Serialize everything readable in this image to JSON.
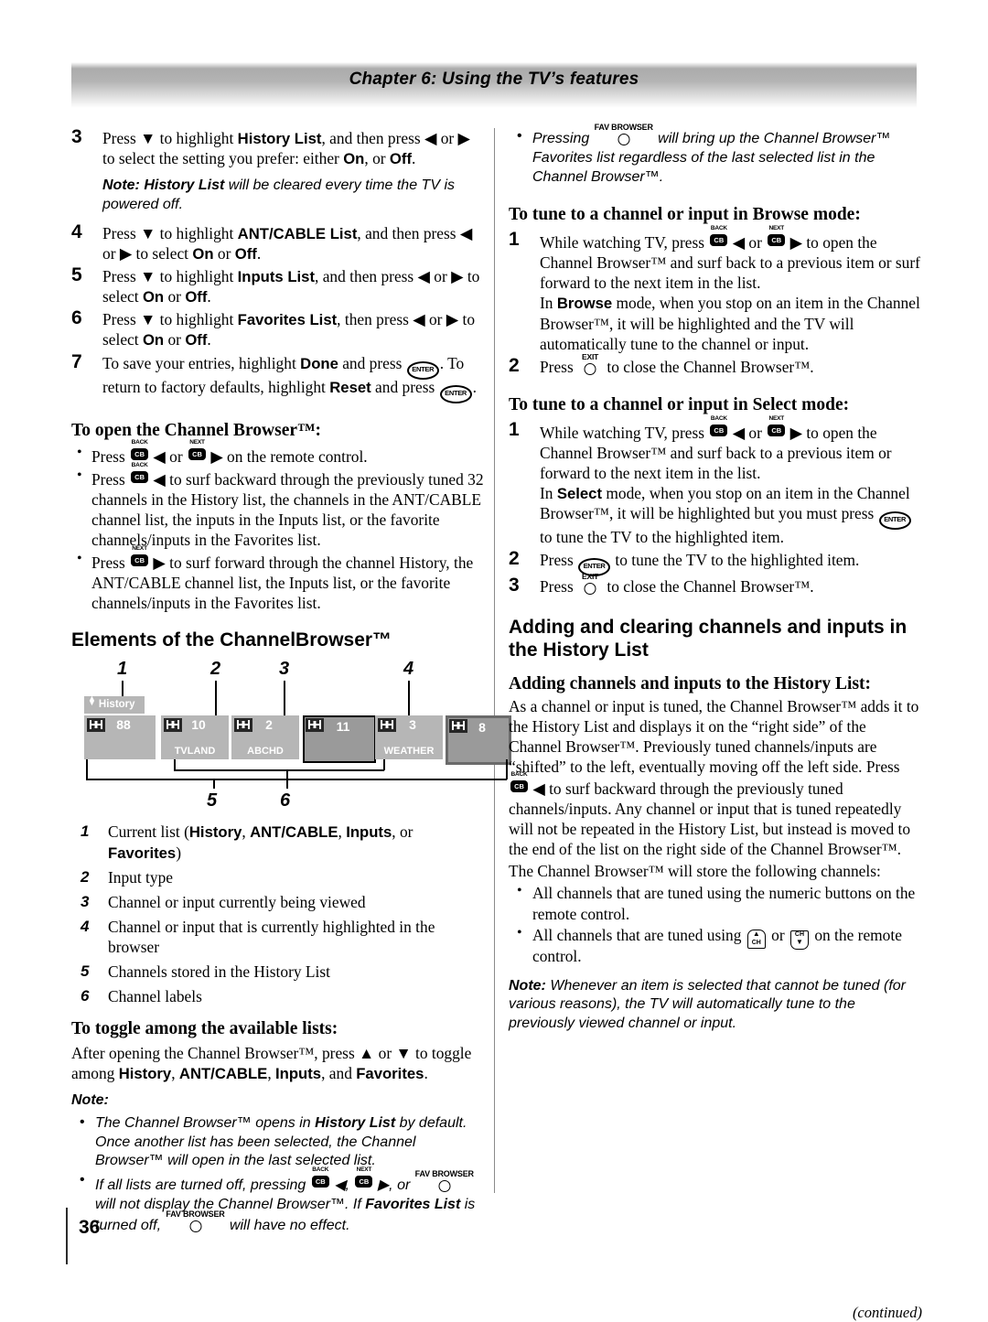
{
  "header": {
    "chapter_title": "Chapter 6: Using the TV’s features"
  },
  "footer": {
    "page_number": "36",
    "continued": "(continued)"
  },
  "left_column": {
    "steps": [
      {
        "num": "3",
        "text_1": "Press ▼ to highlight ",
        "bold_1": "History List",
        "text_2": ", and then press ◀ or ▶ to select the setting you prefer: either ",
        "bold_2": "On",
        "text_3": ", or ",
        "bold_3": "Off",
        "text_4": "."
      },
      {
        "num": "4",
        "text_1": "Press ▼ to highlight ",
        "bold_1": "ANT/CABLE List",
        "text_2": ", and then press ◀ or ▶ to select ",
        "bold_2": "On",
        "text_3": " or ",
        "bold_3": "Off",
        "text_4": "."
      },
      {
        "num": "5",
        "text_1": "Press ▼ to highlight ",
        "bold_1": "Inputs List",
        "text_2": ", and then press ◀ or ▶ to select ",
        "bold_2": "On",
        "text_3": " or ",
        "bold_3": "Off",
        "text_4": "."
      },
      {
        "num": "6",
        "text_1": "Press ▼ to highlight ",
        "bold_1": "Favorites List",
        "text_2": ", then press ◀ or ▶ to select ",
        "bold_2": "On",
        "text_3": " or ",
        "bold_3": "Off",
        "text_4": "."
      }
    ],
    "note_history": {
      "label": "Note: History List",
      "text": " will be cleared every time the TV is powered off."
    },
    "step7": {
      "num": "7",
      "part_1": "To save your entries, highlight ",
      "bold_done": "Done",
      "part_2": " and press ",
      "part_3": ". To return to factory defaults, highlight ",
      "bold_reset": "Reset",
      "part_4": " and press ",
      "part_5": "."
    },
    "open_browser": {
      "heading": "To open the Channel Browser™:",
      "bullets": [
        {
          "pre": "Press ",
          "mid": " ◀ or ",
          "post": " ▶ on the remote control.",
          "type": "two-key"
        },
        {
          "pre": "Press ",
          "post": " ◀ to surf backward through the previously tuned 32 channels in the History list, the channels in the ANT/CABLE channel list, the inputs in the Inputs list, or the favorite channels/inputs in the Favorites list.",
          "type": "back"
        },
        {
          "pre": "Press ",
          "post": " ▶ to surf forward through the channel History, the ANT/CABLE channel list, the Inputs list, or the favorite channels/inputs in the Favorites list.",
          "type": "next"
        }
      ]
    },
    "elements_heading": "Elements of the ChannelBrowser™",
    "figure": {
      "callouts": [
        "1",
        "2",
        "3",
        "4",
        "5",
        "6"
      ],
      "list_tab": "History",
      "cells": [
        {
          "channel": "88",
          "label": "",
          "state": "normal"
        },
        {
          "channel": "10",
          "label": "TVLAND",
          "state": "normal"
        },
        {
          "channel": "2",
          "label": "ABCHD",
          "state": "normal"
        },
        {
          "channel": "11",
          "label": "",
          "state": "viewing"
        },
        {
          "channel": "3",
          "label": "WEATHER",
          "state": "normal"
        },
        {
          "channel": "8",
          "label": "",
          "state": "highlighted"
        }
      ],
      "legend": [
        {
          "num": "1",
          "pre": "Current list (",
          "b1": "History",
          "s1": ", ",
          "b2": "ANT/CABLE",
          "s2": ", ",
          "b3": "Inputs",
          "s3": ", or ",
          "b4": "Favorites",
          "post": ")"
        },
        {
          "num": "2",
          "text": "Input type"
        },
        {
          "num": "3",
          "text": "Channel or input currently being viewed"
        },
        {
          "num": "4",
          "text": "Channel or input that is currently highlighted in the browser"
        },
        {
          "num": "5",
          "text": "Channels stored in the History List"
        },
        {
          "num": "6",
          "text": "Channel labels"
        }
      ]
    },
    "toggle": {
      "heading": "To toggle among the available lists:",
      "p1": "After opening the Channel Browser™, press ▲ or ▼ to toggle among ",
      "b1": "History",
      "s1": ", ",
      "b2": "ANT/CABLE",
      "s2": ", ",
      "b3": "Inputs",
      "s3": ", and ",
      "b4": "Favorites",
      "s4": ".",
      "note_label": "Note:",
      "note_b1_pre": "The Channel Browser™ opens in ",
      "note_b1_bold": "History List",
      "note_b1_post": " by default. Once another list has been selected, the Channel Browser™ will open in the last selected list.",
      "note_b2_pre": "If all lists are turned off, pressing ",
      "note_b2_mid1": " ◀, ",
      "note_b2_mid2": " ▶, or ",
      "note_b2_mid3": " will not display the Channel Browser™. If ",
      "note_b2_bold": "Favorites List",
      "note_b2_mid4": " is turned off, ",
      "note_b2_post": " will have no effect."
    }
  },
  "right_column": {
    "fav_note": {
      "pre": "Pressing ",
      "post": " will bring up the Channel Browser™ Favorites list regardless of the last selected list in the Channel Browser™."
    },
    "browse": {
      "heading": "To tune to a channel or input in Browse mode:",
      "step1": {
        "num": "1",
        "pre": "While watching TV, press ",
        "mid": " ◀ or ",
        "post": " ▶ to open the Channel Browser™ and surf back to a previous item or surf forward to the next item in the list.",
        "line2_pre": "In ",
        "line2_bold": "Browse",
        "line2_post": " mode, when you stop on an item in the Channel Browser™, it will be highlighted and the TV will automatically tune to the channel or input."
      },
      "step2": {
        "num": "2",
        "pre": "Press ",
        "post": " to close the Channel Browser™."
      }
    },
    "select": {
      "heading": "To tune to a channel or input in Select mode:",
      "step1": {
        "num": "1",
        "pre": "While watching TV, press ",
        "mid": " ◀ or ",
        "post": " ▶ to open the Channel Browser™ and surf back to a previous item or forward to the next item in the list.",
        "line2_pre": "In ",
        "line2_bold": "Select",
        "line2_mid": " mode, when you stop on an item in the Channel Browser™, it will be highlighted but you must press ",
        "line2_post": " to tune the TV to the highlighted item."
      },
      "step2": {
        "num": "2",
        "pre": "Press ",
        "post": " to tune the TV to the highlighted item."
      },
      "step3": {
        "num": "3",
        "pre": "Press ",
        "post": " to close the Channel Browser™."
      }
    },
    "adding": {
      "heading": "Adding and clearing channels and inputs in the History List",
      "subheading": "Adding channels and inputs to the History List:",
      "p1_a": "As a channel or input is tuned, the Channel Browser™ adds it to the History List and displays it on the “right side” of the Channel Browser™. Previously tuned channels/inputs are “shifted” to the left, eventually moving off the left side. Press ",
      "p1_b": " ◀ to surf backward through the previously tuned channels/inputs. Any channel or input that is tuned repeatedly will not be repeated in the History List, but instead is moved to the end of the list on the right side of the Channel Browser™.",
      "p2": "The Channel Browser™ will store the following channels:",
      "bullet1": "All channels that are tuned using the numeric buttons on the remote control.",
      "bullet2_pre": "All channels that are tuned using ",
      "bullet2_mid": " or ",
      "bullet2_post": " on the remote control.",
      "note_label": "Note:",
      "note_text": " Whenever an item is selected that cannot be tuned (for various reasons), the TV will automatically tune to the previously viewed channel or input."
    }
  },
  "icons": {
    "back_key_caption": "BACK",
    "next_key_caption": "NEXT",
    "cb_key_face": "CB",
    "enter_key": "ENTER",
    "exit_key": "EXIT",
    "fav_browser_key": "FAV BROWSER",
    "ch_label": "CH"
  }
}
